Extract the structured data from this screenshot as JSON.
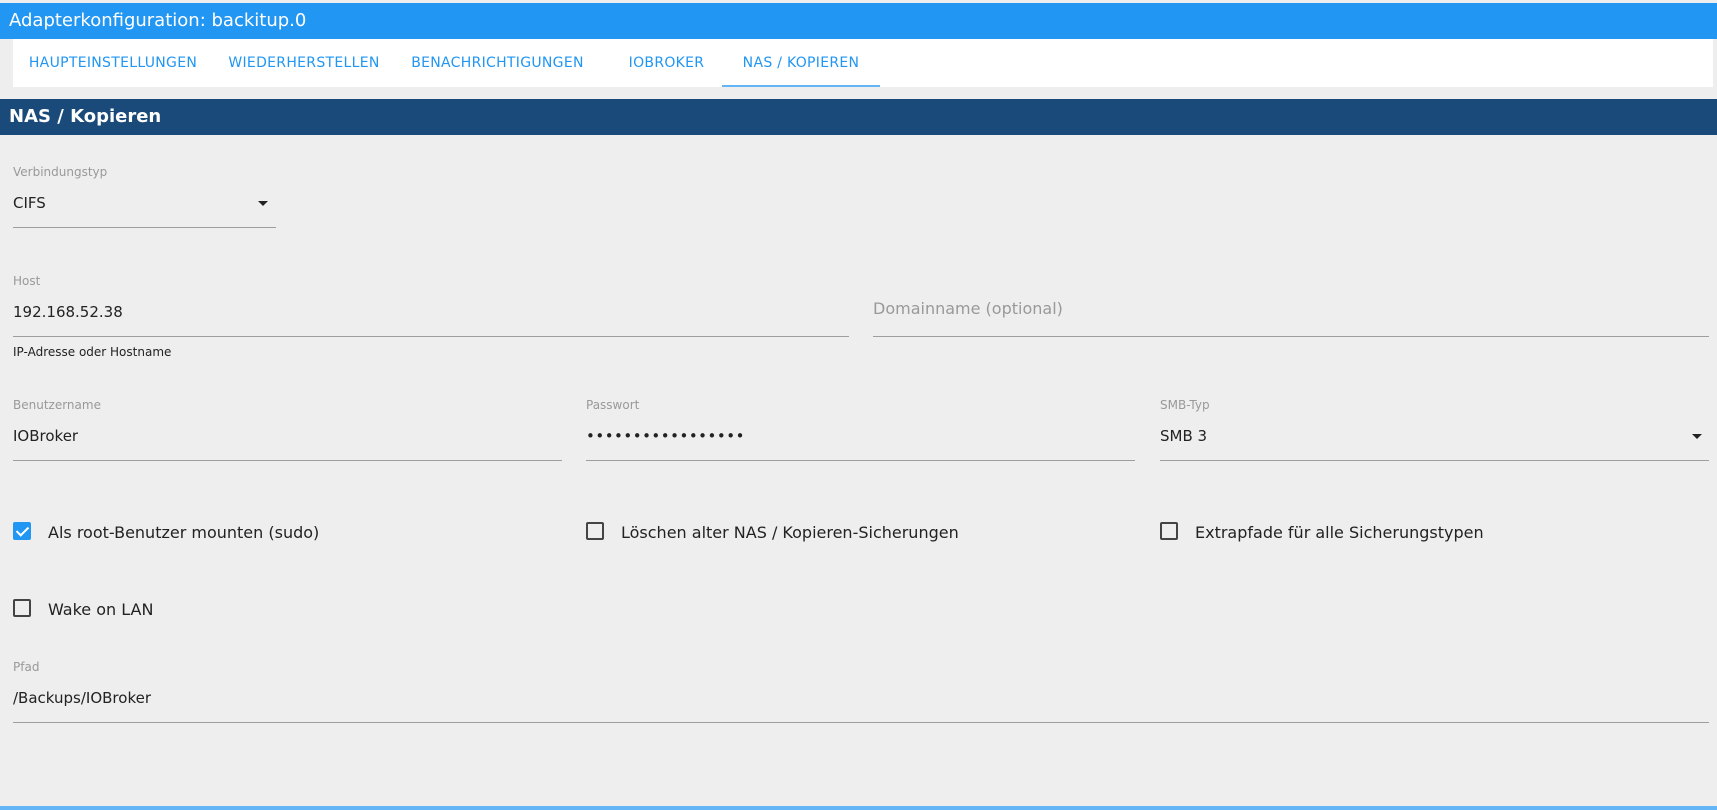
{
  "window": {
    "title": "Adapterkonfiguration: backitup.0"
  },
  "tabs": [
    {
      "label": "HAUPTEINSTELLUNGEN"
    },
    {
      "label": "WIEDERHERSTELLEN"
    },
    {
      "label": "BENACHRICHTIGUNGEN"
    },
    {
      "label": "IOBROKER"
    },
    {
      "label": "NAS / KOPIEREN",
      "active": true
    }
  ],
  "section": {
    "title": "NAS / Kopieren"
  },
  "fields": {
    "connection_type": {
      "label": "Verbindungstyp",
      "value": "CIFS"
    },
    "host": {
      "label": "Host",
      "value": "192.168.52.38",
      "helper": "IP-Adresse oder Hostname"
    },
    "domain": {
      "placeholder": "Domainname (optional)"
    },
    "username": {
      "label": "Benutzername",
      "value": "IOBroker"
    },
    "password": {
      "label": "Passwort",
      "value": "•••••••••••••••••"
    },
    "smb_type": {
      "label": "SMB-Typ",
      "value": "SMB 3"
    },
    "path": {
      "label": "Pfad",
      "value": "/Backups/IOBroker"
    }
  },
  "checkboxes": {
    "sudo": {
      "label": "Als root-Benutzer mounten (sudo)",
      "checked": true
    },
    "delete_old": {
      "label": "Löschen alter NAS / Kopieren-Sicherungen",
      "checked": false
    },
    "extra_paths": {
      "label": "Extrapfade für alle Sicherungstypen",
      "checked": false
    },
    "wol": {
      "label": "Wake on LAN",
      "checked": false
    }
  },
  "colors": {
    "titlebar": "#2196f3",
    "section_header": "#1a4a7a",
    "accent": "#2196f3",
    "background": "#eeeeee"
  }
}
